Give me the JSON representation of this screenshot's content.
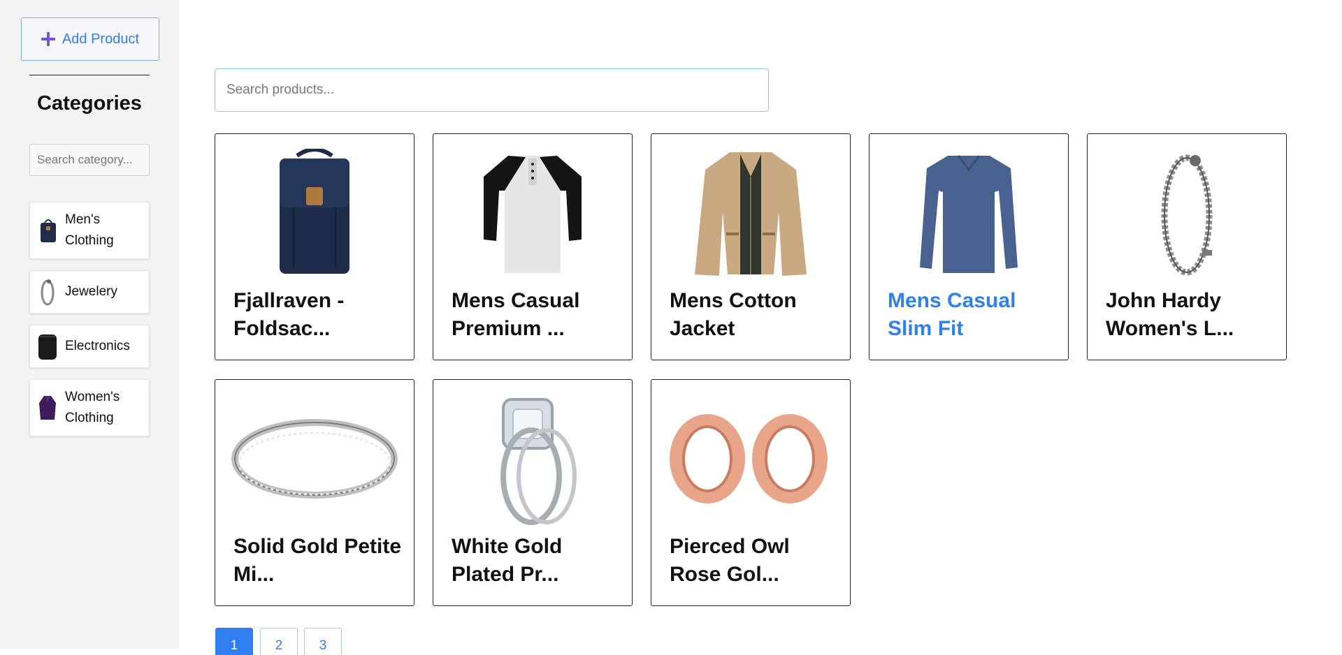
{
  "sidebar": {
    "add_product_label": "Add Product",
    "categories_title": "Categories",
    "category_search_placeholder": "Search category...",
    "categories": [
      {
        "label": "Men's Clothing",
        "icon": "backpack-thumb"
      },
      {
        "label": "Jewelery",
        "icon": "bracelet-thumb"
      },
      {
        "label": "Electronics",
        "icon": "hard-drive-thumb"
      },
      {
        "label": "Women's Clothing",
        "icon": "purple-jacket-thumb"
      }
    ]
  },
  "main": {
    "search_placeholder": "Search products...",
    "products": [
      {
        "title": "Fjallraven - Foldsac...",
        "image": "navy-backpack"
      },
      {
        "title": "Mens Casual Premium ...",
        "image": "raglan-tshirt"
      },
      {
        "title": "Mens Cotton Jacket",
        "image": "khaki-jacket"
      },
      {
        "title": "Mens Casual Slim Fit",
        "image": "blue-longsleeve"
      },
      {
        "title": "John Hardy Women's L...",
        "image": "dragon-bracelet"
      },
      {
        "title": "Solid Gold Petite Mi...",
        "image": "silver-band-ring"
      },
      {
        "title": "White Gold Plated Pr...",
        "image": "halo-engagement-ring"
      },
      {
        "title": "Pierced Owl Rose Gol...",
        "image": "rose-gold-plugs"
      }
    ],
    "pagination": {
      "pages": [
        "1",
        "2",
        "3"
      ],
      "current": "1"
    }
  },
  "colors": {
    "accent": "#2f80ed",
    "sidebar_bg": "#f3f3f3",
    "plus_icon": "#6f55d6"
  }
}
